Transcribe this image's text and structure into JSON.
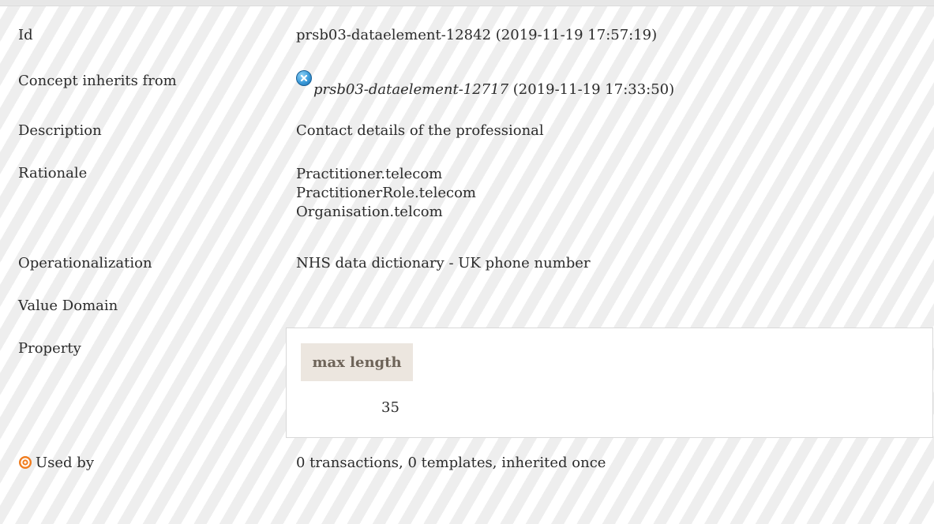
{
  "rows": {
    "id": {
      "label": "Id",
      "value": "prsb03-dataelement-12842 (2019-11-19 17:57:19)"
    },
    "inherits": {
      "label": "Concept inherits from",
      "link": "prsb03-dataelement-12717",
      "date": " (2019-11-19 17:33:50)",
      "icon": "close-circle-icon"
    },
    "description": {
      "label": "Description",
      "value": "Contact details of the professional"
    },
    "rationale": {
      "label": "Rationale",
      "lines": [
        "Practitioner.telecom",
        "PractitionerRole.telecom",
        "Organisation.telcom"
      ]
    },
    "operationalization": {
      "label": "Operationalization",
      "value": "NHS data dictionary - UK phone number"
    },
    "value_domain": {
      "label": "Value Domain"
    },
    "property": {
      "label": "Property",
      "header": "max length",
      "value": "35"
    },
    "used_by": {
      "label": "Used by",
      "value": "0 transactions, 0 templates, inherited once",
      "icon": "target-icon"
    }
  },
  "colors": {
    "accent_orange": "#f07b1c",
    "icon_blue": "#3a9ad9",
    "header_bg": "#ece6df"
  }
}
